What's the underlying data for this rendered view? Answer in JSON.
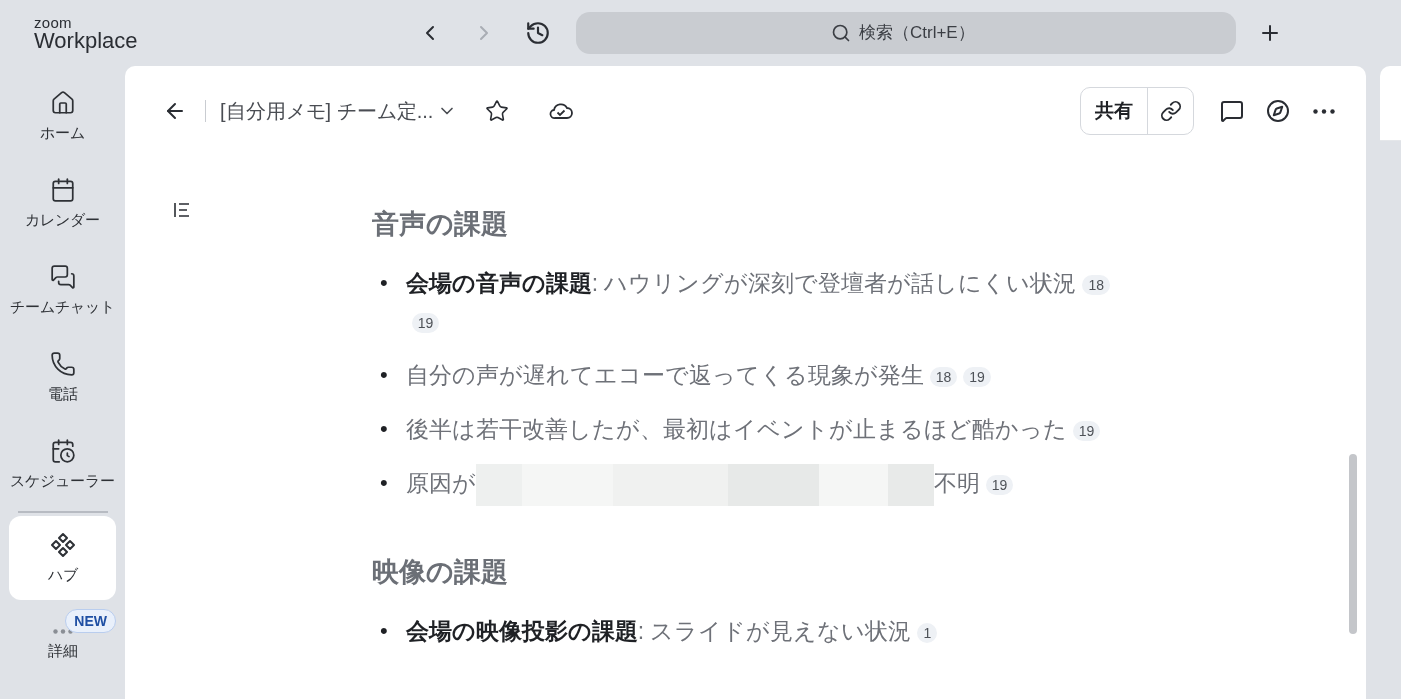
{
  "app": {
    "logo_top": "zoom",
    "logo_bottom": "Workplace"
  },
  "toolbar": {
    "back_disabled": false,
    "forward_disabled": true,
    "search": {
      "placeholder": "検索（Ctrl+E）"
    }
  },
  "sidebar": {
    "items": [
      {
        "kind": "home",
        "label": "ホーム",
        "selected": false
      },
      {
        "kind": "calendar",
        "label": "カレンダー",
        "selected": false
      },
      {
        "kind": "chat",
        "label": "チームチャット",
        "selected": false
      },
      {
        "kind": "phone",
        "label": "電話",
        "selected": false
      },
      {
        "kind": "scheduler",
        "label": "スケジューラー",
        "selected": false
      },
      {
        "kind": "divider"
      },
      {
        "kind": "hub",
        "label": "ハブ",
        "selected": true
      },
      {
        "kind": "more",
        "label": "詳細",
        "selected": false,
        "badge": "NEW"
      }
    ]
  },
  "document": {
    "title": "[自分用メモ] チーム定...",
    "share_label": "共有",
    "sections": [
      {
        "heading": "音声の課題",
        "bullet": "•",
        "items": [
          {
            "segments": [
              {
                "kind": "text",
                "text": "**会場の音声の課題**: ハウリングが深刻で登壇者が話しにくい状況"
              }
            ],
            "citations": [
              "18",
              "19"
            ]
          },
          {
            "segments": [
              {
                "kind": "text",
                "text": "自分の声が遅れてエコーで返ってくる現象が発生"
              }
            ],
            "citations": [
              "18",
              "19"
            ]
          },
          {
            "segments": [
              {
                "kind": "text",
                "text": "後半は若干改善したが、最初はイベントが止まるほど酷かった"
              }
            ],
            "citations": [
              "19"
            ]
          },
          {
            "segments": [
              {
                "kind": "text",
                "text": "原因が"
              },
              {
                "kind": "redacted"
              },
              {
                "kind": "text",
                "text": "不明"
              }
            ],
            "citations": [
              "19"
            ]
          }
        ]
      },
      {
        "heading": "映像の課題",
        "bullet": "•",
        "items": [
          {
            "segments": [
              {
                "kind": "text",
                "text": "**会場の映像投影の課題**: スライドが見えない状況"
              }
            ],
            "citations": [
              "1"
            ]
          }
        ]
      }
    ]
  }
}
